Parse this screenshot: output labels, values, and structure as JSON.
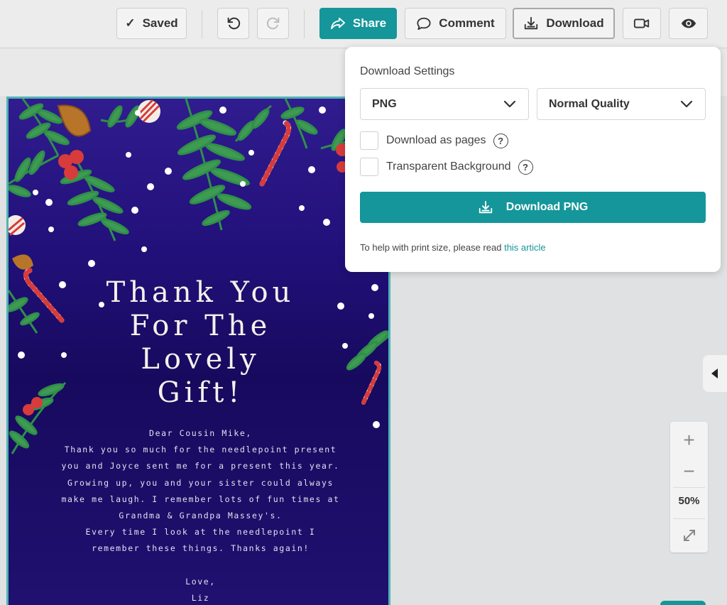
{
  "toolbar": {
    "saved_label": "Saved",
    "share_label": "Share",
    "comment_label": "Comment",
    "download_label": "Download",
    "icons": [
      "check-icon",
      "undo-icon",
      "redo-icon",
      "share-icon",
      "comment-icon",
      "download-icon",
      "video-icon",
      "eye-icon"
    ]
  },
  "card": {
    "title_lines": [
      "Thank You",
      "For The",
      "Lovely",
      "Gift!"
    ],
    "body_lines": [
      "Dear Cousin Mike,",
      "Thank you so much for the needlepoint present",
      "you and Joyce sent me for a present this year.",
      "Growing up, you and your sister could always",
      "make me laugh. I remember lots of fun times at",
      "Grandma & Grandpa Massey's.",
      "Every time I look at the needlepoint I",
      "remember these things. Thanks again!",
      "",
      "Love,",
      "Liz"
    ]
  },
  "download_panel": {
    "title": "Download Settings",
    "format": "PNG",
    "quality": "Normal Quality",
    "option_pages": "Download as pages",
    "option_transparent": "Transparent Background",
    "help_glyph": "?",
    "download_button": "Download PNG",
    "help_text": "To help with print size, please read",
    "help_link": "this article"
  },
  "zoom": {
    "plus": "+",
    "minus": "−",
    "level": "50%"
  },
  "colors": {
    "accent": "#14969a",
    "card_bg": "#22107a",
    "card_border": "#4fb3b5"
  }
}
